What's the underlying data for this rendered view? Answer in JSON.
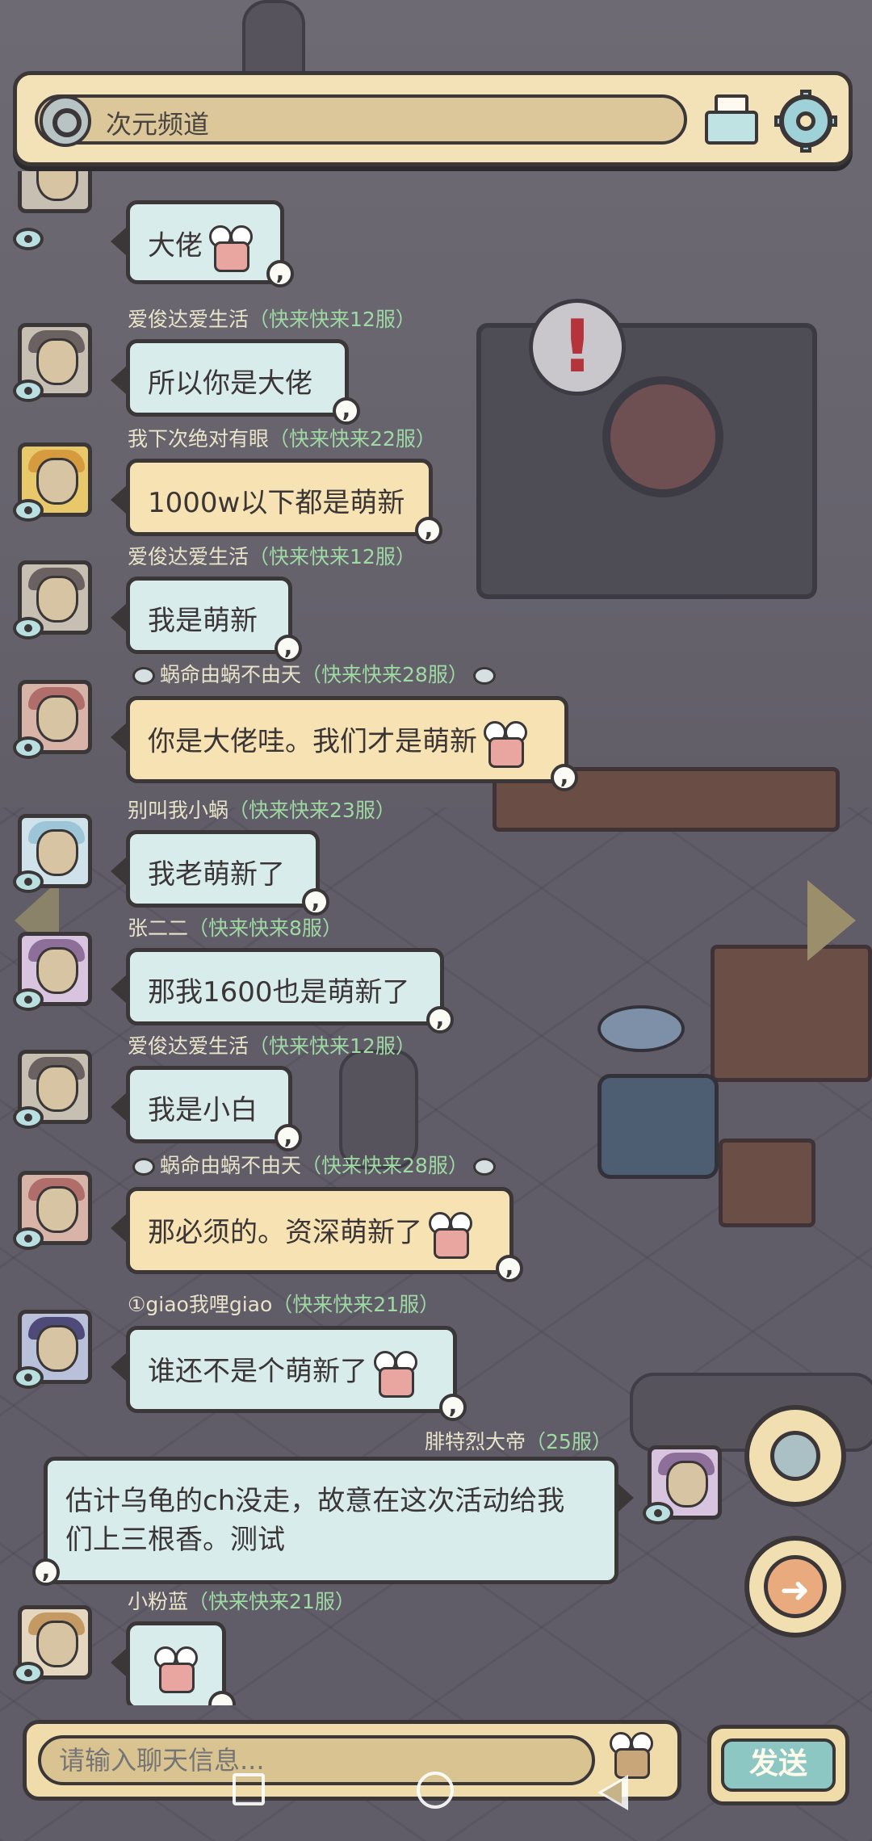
{
  "header": {
    "channel_name": "次元频道",
    "mail_icon": "mail-icon",
    "settings_icon": "gear-icon"
  },
  "messages": [
    {
      "user": "",
      "server": "",
      "text": "大佬",
      "sticker": true,
      "side": "left",
      "color": "blue"
    },
    {
      "user": "爱俊达爱生活",
      "server": "（快来快来12服）",
      "text": "所以你是大佬",
      "sticker": false,
      "side": "left",
      "color": "blue"
    },
    {
      "user": "我下次绝对有眼",
      "server": "（快来快来22服）",
      "text": "1000w以下都是萌新",
      "sticker": false,
      "side": "left",
      "color": "yellow"
    },
    {
      "user": "爱俊达爱生活",
      "server": "（快来快来12服）",
      "text": "我是萌新",
      "sticker": false,
      "side": "left",
      "color": "blue"
    },
    {
      "user": "蜗命由蜗不由天",
      "server": "（快来快来28服）",
      "text": "你是大佬哇。我们才是萌新",
      "sticker": true,
      "side": "left",
      "color": "yellow"
    },
    {
      "user": "别叫我小蜗",
      "server": "（快来快来23服）",
      "text": "我老萌新了",
      "sticker": false,
      "side": "left",
      "color": "blue"
    },
    {
      "user": "张二二",
      "server": "（快来快来8服）",
      "text": "那我1600也是萌新了",
      "sticker": false,
      "side": "left",
      "color": "blue"
    },
    {
      "user": "爱俊达爱生活",
      "server": "（快来快来12服）",
      "text": "我是小白",
      "sticker": false,
      "side": "left",
      "color": "blue"
    },
    {
      "user": "蜗命由蜗不由天",
      "server": "（快来快来28服）",
      "text": "那必须的。资深萌新了",
      "sticker": true,
      "side": "left",
      "color": "yellow"
    },
    {
      "user": "①giao我哩giao",
      "server": "（快来快来21服）",
      "text": "谁还不是个萌新了",
      "sticker": true,
      "side": "left",
      "color": "blue"
    },
    {
      "user": "腓特烈大帝",
      "server": "（25服）",
      "text_line1": "估计乌龟的ch没走，故意在这次活动给我",
      "text_line2": "们上三根香。测试",
      "sticker": false,
      "side": "right",
      "color": "blue"
    },
    {
      "user": "小粉蓝",
      "server": "（快来快来21服）",
      "text": "",
      "sticker": true,
      "side": "left",
      "color": "blue"
    }
  ],
  "input": {
    "placeholder": "请输入聊天信息...",
    "send_label": "发送",
    "emoji_icon": "snail-emoji-icon"
  },
  "side_buttons": {
    "world": "world-channel-icon",
    "next": "arrow-right-icon"
  },
  "colors": {
    "bubble_blue": "#d8ecec",
    "bubble_yellow": "#f6e2b2",
    "server_tag": "#9fd9a4",
    "panel": "#f3e2b8",
    "outline": "#3b3738"
  }
}
